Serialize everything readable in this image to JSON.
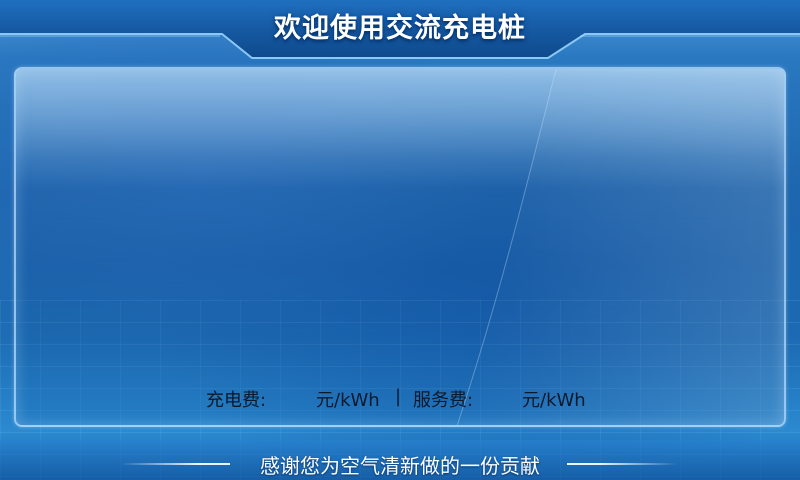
{
  "header": {
    "title": "欢迎使用交流充电桩"
  },
  "fees": {
    "charging_label": "充电费:",
    "charging_value": "",
    "charging_unit": "元/kWh",
    "separator": "|",
    "service_label": "服务费:",
    "service_value": "",
    "service_unit": "元/kWh"
  },
  "footer": {
    "text": "感谢您为空气清新做的一份贡献"
  },
  "colors": {
    "background": "#1d67ad",
    "header_band": "#1a5fa8",
    "panel_border": "#bee1ff",
    "text_dark": "#0a1a2c",
    "text_light": "#ffffff"
  }
}
